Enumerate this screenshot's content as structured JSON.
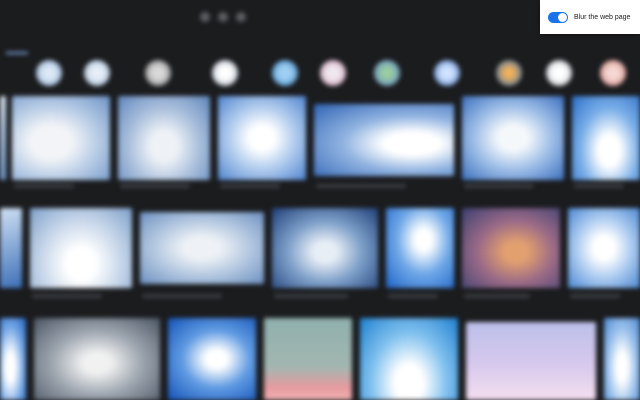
{
  "extension_popup": {
    "toggle_label": "Blur the web page",
    "toggle_state": "on",
    "toggle_color": "#1a73e8"
  },
  "search_page": {
    "theme": "dark",
    "background_color": "#1b1c1e",
    "accent_color": "#8ab4f8"
  }
}
